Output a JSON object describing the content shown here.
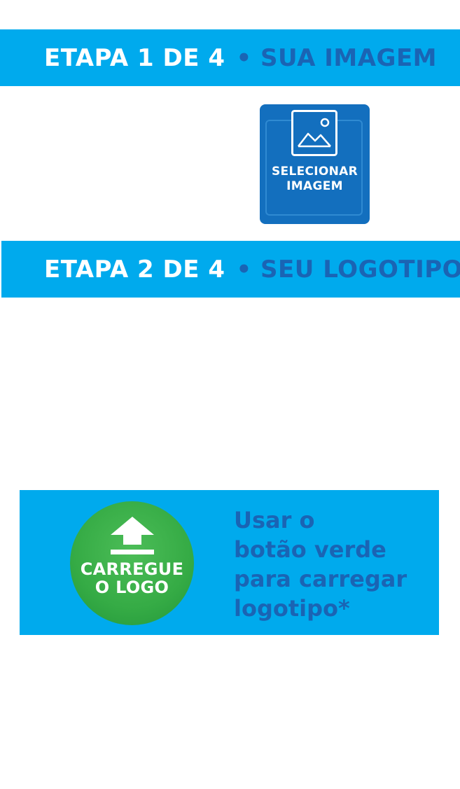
{
  "steps": [
    {
      "prefix": "ETAPA 1 DE 4",
      "suffix": "• SUA IMAGEM"
    },
    {
      "prefix": "ETAPA 2 DE 4",
      "suffix": "• SEU LOGOTIPO"
    }
  ],
  "select_image": {
    "icon": "image-icon",
    "line1": "SELECIONAR",
    "line2": "IMAGEM"
  },
  "upload_logo": {
    "icon": "upload-arrow-icon",
    "line1": "CARREGUE",
    "line2": "O LOGO"
  },
  "instruction": {
    "lines": [
      "Usar o",
      "botão verde",
      "para carregar",
      "logotipo*"
    ]
  },
  "colors": {
    "banner": "#00aaed",
    "dark_blue_text": "#1a64b4",
    "select_button": "#136fbe",
    "upload_button": "#35ab45"
  }
}
